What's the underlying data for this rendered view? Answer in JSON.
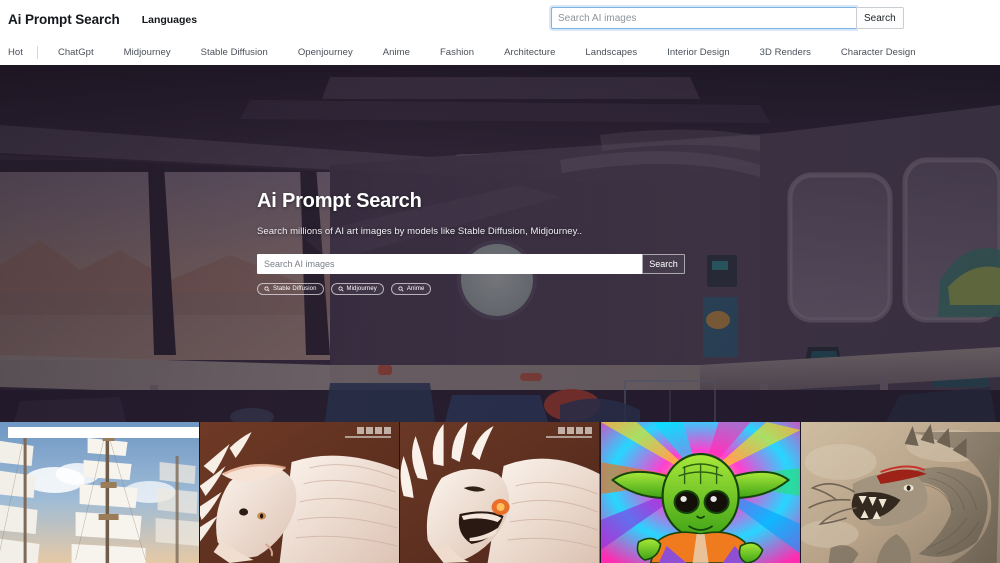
{
  "header": {
    "brand": "Ai Prompt Search",
    "languages_label": "Languages",
    "search": {
      "placeholder": "Search AI images",
      "value": "",
      "button_label": "Search"
    }
  },
  "category_nav": {
    "items": [
      {
        "label": "Hot"
      },
      {
        "label": "ChatGpt"
      },
      {
        "label": "Midjourney"
      },
      {
        "label": "Stable Diffusion"
      },
      {
        "label": "Openjourney"
      },
      {
        "label": "Anime"
      },
      {
        "label": "Fashion"
      },
      {
        "label": "Architecture"
      },
      {
        "label": "Landscapes"
      },
      {
        "label": "Interior Design"
      },
      {
        "label": "3D Renders"
      },
      {
        "label": "Character Design"
      }
    ]
  },
  "hero": {
    "title": "Ai Prompt Search",
    "subtitle": "Search millions of AI art images by models like Stable Diffusion, Midjourney..",
    "search": {
      "placeholder": "Search AI images",
      "value": "",
      "button_label": "Search"
    },
    "chips": [
      {
        "label": "Stable Diffusion",
        "icon": "search-icon"
      },
      {
        "label": "Midjourney",
        "icon": "search-icon"
      },
      {
        "label": "Anime",
        "icon": "search-icon"
      }
    ],
    "background_description": "Dark purple sci-fi spaceship interior with large windows, desert landscape and planet view"
  },
  "gallery": {
    "items": [
      {
        "alt": "Tall sailing ship with white sails under blue sky with clouds"
      },
      {
        "alt": "White dragon creature sculpture with horns on brown background"
      },
      {
        "alt": "White dragon creature sculpture with open mouth on brown background"
      },
      {
        "alt": "Psychedelic neon rainbow Yoda illustration"
      },
      {
        "alt": "Detailed Asian dragon illustration on tan background"
      }
    ]
  },
  "colors": {
    "accent_focus": "#7db3e8",
    "hero_bg": "#2b2233",
    "text_dark": "#14181c",
    "nav_text": "#4a5058"
  }
}
